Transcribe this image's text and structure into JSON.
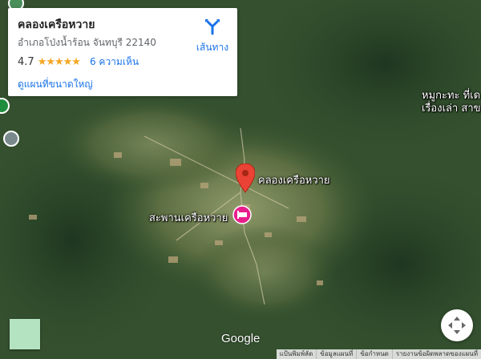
{
  "place_card": {
    "title": "คลองเครือหวาย",
    "address": "อำเภอโป่งน้ำร้อน จันทบุรี 22140",
    "rating": "4.7",
    "stars": "★★★★★",
    "reviews": "6 ความเห็น",
    "large_map_link": "ดูแผนที่ขนาดใหญ่",
    "directions_label": "เส้นทาง"
  },
  "map_labels": {
    "place_pin_label": "คลองเครือหวาย",
    "bridge_label": "สะพานเครือหวาย",
    "edge_line1": "หมูกะทะ ที่เด",
    "edge_line2": "เรื่องเล่า สาข"
  },
  "logo_text": "Google",
  "footer": {
    "keyboard_shortcuts": "แป้นพิมพ์ลัด",
    "map_data": "ข้อมูลแผนที่",
    "terms": "ข้อกำหนด",
    "report_error": "รายงานข้อผิดพลาดของแผนที่"
  },
  "colors": {
    "pin": "#ea4335",
    "hotel_marker": "#e91e8c",
    "link": "#1a73e8",
    "star": "#f5a623"
  }
}
